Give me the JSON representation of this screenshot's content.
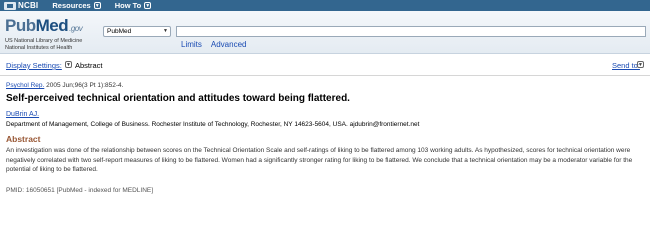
{
  "topbar": {
    "logo_text": "NCBI",
    "nav": [
      {
        "label": "Resources"
      },
      {
        "label": "How To"
      }
    ]
  },
  "header": {
    "logo_pub": "Pub",
    "logo_med": "Med",
    "logo_gov": ".gov",
    "logo_sub1": "US National Library of Medicine",
    "logo_sub2": "National Institutes of Health",
    "database_value": "PubMed",
    "search_value": "",
    "links": {
      "limits": "Limits",
      "advanced": "Advanced"
    }
  },
  "display": {
    "settings_label": "Display Settings:",
    "mode": "Abstract",
    "send_to_label": "Send to:"
  },
  "article": {
    "journal": "Psychol Rep.",
    "citation": " 2005 Jun;96(3 Pt 1):852-4.",
    "title": "Self-perceived technical orientation and attitudes toward being flattered.",
    "author": "DuBrin AJ.",
    "affiliation": "Department of Management, College of Business. Rochester Institute of Technology, Rochester, NY 14623-5604, USA. ajdubrin@frontiernet.net",
    "abstract_heading": "Abstract",
    "abstract_text": "An investigation was done of the relationship between scores on the Technical Orientation Scale and self-ratings of liking to be flattered among 103 working adults. As hypothesized, scores for technical orientation were negatively correlated with two self-report measures of liking to be flattered. Women had a significantly stronger rating for liking to be flattered. We conclude that a technical orientation may be a moderator variable for the potential of liking to be flattered.",
    "pmid_line": "PMID: 16050651 [PubMed - indexed for MEDLINE]"
  },
  "colors": {
    "topbar": "#33668f",
    "link": "#1a4bb3",
    "abstract_heading": "#985735"
  },
  "icons": [
    "ncbi-logo-icon",
    "chevron-down-icon"
  ]
}
